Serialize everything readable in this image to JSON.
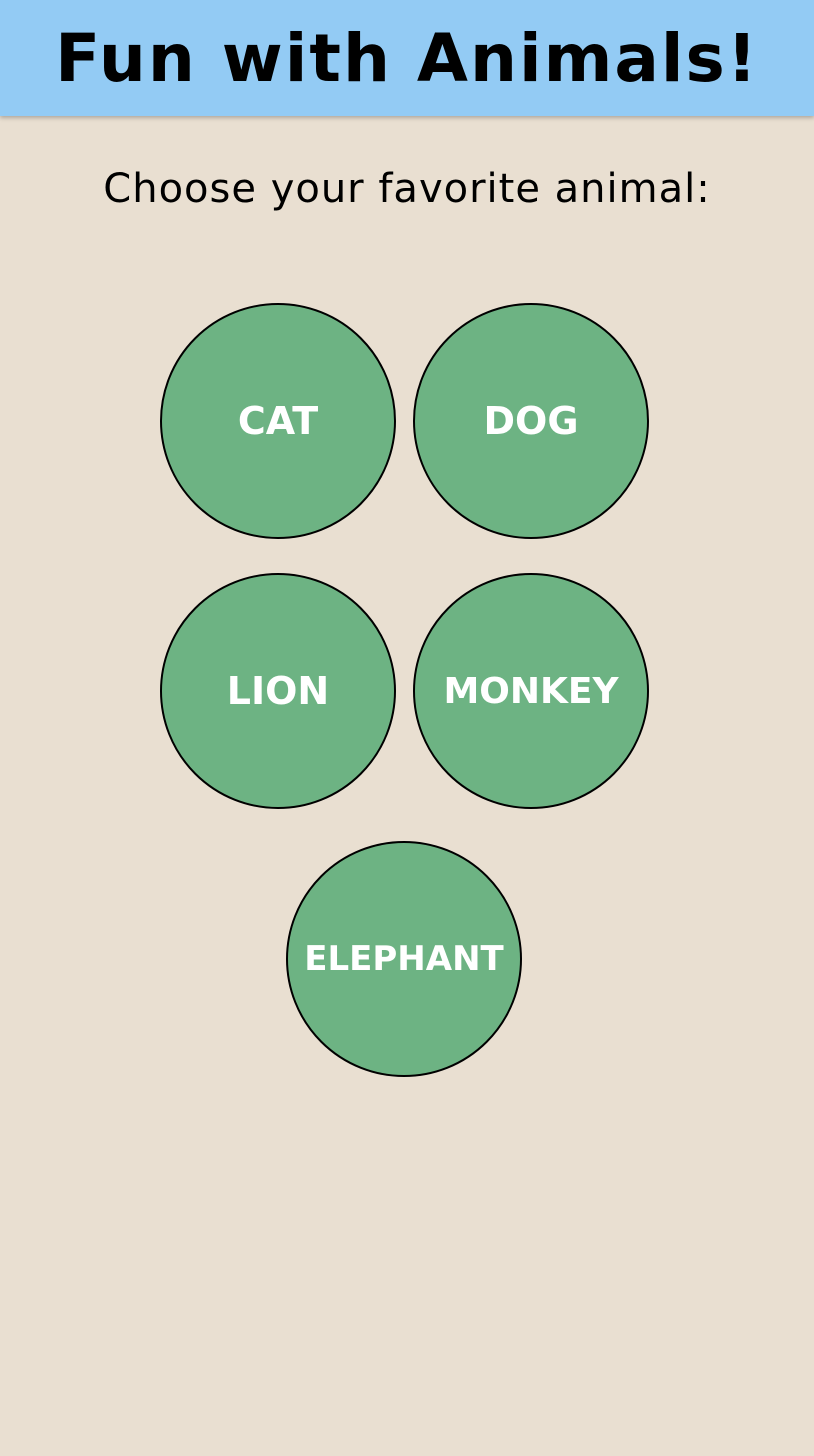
{
  "header": {
    "title": "Fun with Animals!"
  },
  "main": {
    "prompt": "Choose your favorite animal:",
    "animals": [
      {
        "label": "CAT"
      },
      {
        "label": "DOG"
      },
      {
        "label": "LION"
      },
      {
        "label": "MONKEY"
      },
      {
        "label": "ELEPHANT"
      }
    ]
  },
  "colors": {
    "header_bg": "#93cbf4",
    "page_bg": "#e9dfd1",
    "button_bg": "#6db383",
    "button_text": "#ffffff"
  }
}
